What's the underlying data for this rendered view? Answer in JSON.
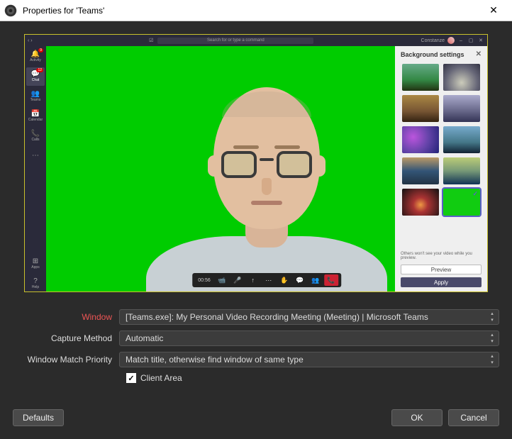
{
  "titlebar": {
    "title": "Properties for 'Teams'",
    "close_glyph": "✕"
  },
  "teams": {
    "search_placeholder": "Search for or type a command",
    "username": "Constanze",
    "rail": [
      {
        "icon": "🔔",
        "label": "Activity",
        "badge": "9"
      },
      {
        "icon": "💬",
        "label": "Chat",
        "badge": "12"
      },
      {
        "icon": "👥",
        "label": "Teams",
        "badge": ""
      },
      {
        "icon": "📅",
        "label": "Calendar",
        "badge": ""
      },
      {
        "icon": "📞",
        "label": "Calls",
        "badge": ""
      },
      {
        "icon": "⋯",
        "label": "More",
        "badge": ""
      }
    ],
    "rail_bottom": [
      {
        "icon": "⊞",
        "label": "Apps"
      },
      {
        "icon": "?",
        "label": "Help"
      }
    ],
    "meeting_bar": {
      "time": "00:56",
      "items": [
        {
          "icon": "📹",
          "name": "camera-icon"
        },
        {
          "icon": "🎤",
          "name": "mic-icon"
        },
        {
          "icon": "↑",
          "name": "share-icon"
        },
        {
          "icon": "⋯",
          "name": "more-icon"
        },
        {
          "icon": "✋",
          "name": "raise-hand-icon"
        },
        {
          "icon": "💬",
          "name": "chat-icon"
        },
        {
          "icon": "👥",
          "name": "people-icon"
        }
      ],
      "hangup": "📞"
    },
    "bg_panel": {
      "title": "Background settings",
      "note": "Others won't see your video while you preview.",
      "preview_btn": "Preview",
      "apply_btn": "Apply",
      "selected_index": 9
    }
  },
  "form": {
    "window_label": "Window",
    "window_value": "[Teams.exe]: My Personal Video Recording Meeting (Meeting) | Microsoft Teams",
    "capture_label": "Capture Method",
    "capture_value": "Automatic",
    "priority_label": "Window Match Priority",
    "priority_value": "Match title, otherwise find window of same type",
    "client_area_label": "Client Area",
    "client_area_checked": true
  },
  "buttons": {
    "defaults": "Defaults",
    "ok": "OK",
    "cancel": "Cancel"
  }
}
